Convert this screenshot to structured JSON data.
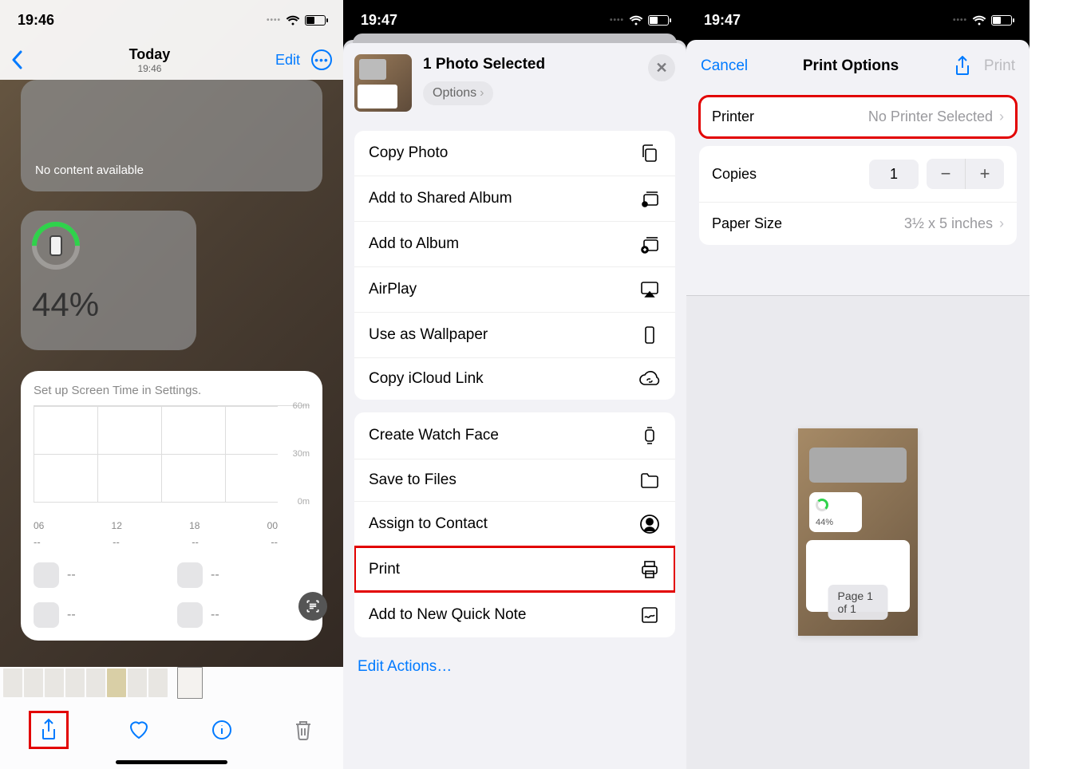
{
  "screen1": {
    "status_time": "19:46",
    "nav": {
      "title": "Today",
      "subtitle": "19:46",
      "edit": "Edit"
    },
    "widget_empty": "No content available",
    "battery_pct": "44%",
    "screen_time_msg": "Set up Screen Time in Settings.",
    "chart_y": [
      "60m",
      "30m",
      "0m"
    ],
    "chart_x": [
      "06",
      "12",
      "18",
      "00"
    ],
    "chart_dashes": [
      "--",
      "--",
      "--",
      "--"
    ]
  },
  "screen2": {
    "status_time": "19:47",
    "header_title": "1 Photo Selected",
    "options_label": "Options",
    "actions_group1": [
      {
        "label": "Copy Photo",
        "icon": "copy"
      },
      {
        "label": "Add to Shared Album",
        "icon": "shared-album"
      },
      {
        "label": "Add to Album",
        "icon": "add-album"
      },
      {
        "label": "AirPlay",
        "icon": "airplay"
      },
      {
        "label": "Use as Wallpaper",
        "icon": "wallpaper"
      },
      {
        "label": "Copy iCloud Link",
        "icon": "icloud-link"
      }
    ],
    "actions_group2": [
      {
        "label": "Create Watch Face",
        "icon": "watch"
      },
      {
        "label": "Save to Files",
        "icon": "folder"
      },
      {
        "label": "Assign to Contact",
        "icon": "contact"
      },
      {
        "label": "Print",
        "icon": "print",
        "highlight": true
      },
      {
        "label": "Add to New Quick Note",
        "icon": "quicknote"
      }
    ],
    "edit_actions": "Edit Actions…"
  },
  "screen3": {
    "status_time": "19:47",
    "cancel": "Cancel",
    "title": "Print Options",
    "print": "Print",
    "printer_label": "Printer",
    "printer_value": "No Printer Selected",
    "copies_label": "Copies",
    "copies_value": "1",
    "paper_label": "Paper Size",
    "paper_value": "3½ x 5 inches",
    "preview_pct": "44%",
    "page_label": "Page 1 of 1"
  }
}
